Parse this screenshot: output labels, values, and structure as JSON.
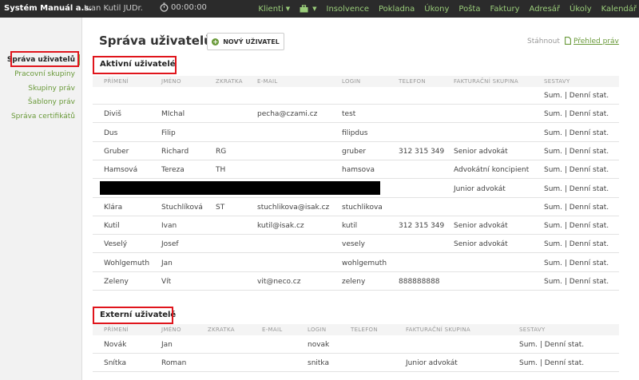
{
  "topbar": {
    "app_title": "Systém Manuál a.s.",
    "user": "Ivan Kutil JUDr.",
    "timer": "00:00:00",
    "nav": [
      {
        "label": "Klienti",
        "dropdown": true
      },
      {
        "label": "",
        "icon": "briefcase-icon",
        "dropdown": true
      },
      {
        "label": "Insolvence"
      },
      {
        "label": "Pokladna"
      },
      {
        "label": "Úkony"
      },
      {
        "label": "Pošta"
      },
      {
        "label": "Faktury"
      },
      {
        "label": "Adresář"
      },
      {
        "label": "Úkoly"
      },
      {
        "label": "Kalendář"
      }
    ]
  },
  "sidebar": {
    "items": [
      {
        "label": "Správa uživatelů",
        "active": true
      },
      {
        "label": "Pracovní skupiny"
      },
      {
        "label": "Skupiny práv"
      },
      {
        "label": "Šablony práv"
      },
      {
        "label": "Správa certifikátů"
      }
    ]
  },
  "header": {
    "title": "Správa uživatelů",
    "new_button": "NOVÝ UŽIVATEL",
    "download": "Stáhnout",
    "rights_overview": "Přehled práv"
  },
  "active_users": {
    "title": "Aktivní uživatelé",
    "columns": [
      "PŘÍMENÍ",
      "JMÉNO",
      "ZKRATKA",
      "E-MAIL",
      "LOGIN",
      "TELEFON",
      "FAKTURAČNÍ SKUPINA",
      "SESTAVY"
    ],
    "rows": [
      {
        "surname": "",
        "name": "",
        "abbr": "",
        "email": "",
        "login": "",
        "phone": "",
        "group": "",
        "reports": "Sum. | Denní stat."
      },
      {
        "surname": "Diviš",
        "name": "MIchal",
        "abbr": "",
        "email": "pecha@czami.cz",
        "login": "test",
        "phone": "",
        "group": "",
        "reports": "Sum. | Denní stat."
      },
      {
        "surname": "Dus",
        "name": "Filip",
        "abbr": "",
        "email": "",
        "login": "filipdus",
        "phone": "",
        "group": "",
        "reports": "Sum. | Denní stat."
      },
      {
        "surname": "Gruber",
        "name": "Richard",
        "abbr": "RG",
        "email": "",
        "login": "gruber",
        "phone": "312 315 349",
        "group": "Senior advokát",
        "reports": "Sum. | Denní stat."
      },
      {
        "surname": "Hamsová",
        "name": "Tereza",
        "abbr": "TH",
        "email": "",
        "login": "hamsova",
        "phone": "",
        "group": "Advokátní koncipient",
        "reports": "Sum. | Denní stat."
      },
      {
        "surname": "",
        "name": "",
        "abbr": "",
        "email": "",
        "login": "",
        "phone": "",
        "group": "Junior advokát",
        "reports": "Sum. | Denní stat.",
        "redacted": true
      },
      {
        "surname": "Klára",
        "name": "Stuchlíková",
        "abbr": "ST",
        "email": "stuchlikova@isak.cz",
        "login": "stuchlikova",
        "phone": "",
        "group": "",
        "reports": "Sum. | Denní stat."
      },
      {
        "surname": "Kutil",
        "name": "Ivan",
        "abbr": "",
        "email": "kutil@isak.cz",
        "login": "kutil",
        "phone": "312 315 349",
        "group": "Senior advokát",
        "reports": "Sum. | Denní stat."
      },
      {
        "surname": "Veselý",
        "name": "Josef",
        "abbr": "",
        "email": "",
        "login": "vesely",
        "phone": "",
        "group": "Senior advokát",
        "reports": "Sum. | Denní stat."
      },
      {
        "surname": "Wohlgemuth",
        "name": "Jan",
        "abbr": "",
        "email": "",
        "login": "wohlgemuth",
        "phone": "",
        "group": "",
        "reports": "Sum. | Denní stat."
      },
      {
        "surname": "Zeleny",
        "name": "Vít",
        "abbr": "",
        "email": "vit@neco.cz",
        "login": "zeleny",
        "phone": "888888888",
        "group": "",
        "reports": "Sum. | Denní stat."
      }
    ]
  },
  "external_users": {
    "title": "Externí uživatelé",
    "columns": [
      "PŘÍMENÍ",
      "JMÉNO",
      "ZKRATKA",
      "E-MAIL",
      "LOGIN",
      "TELEFON",
      "FAKTURAČNÍ SKUPINA",
      "SESTAVY"
    ],
    "rows": [
      {
        "surname": "Novák",
        "name": "Jan",
        "abbr": "",
        "email": "",
        "login": "novak",
        "phone": "",
        "group": "",
        "reports": "Sum. | Denní stat."
      },
      {
        "surname": "Snítka",
        "name": "Roman",
        "abbr": "",
        "email": "",
        "login": "snitka",
        "phone": "",
        "group": "Junior advokát",
        "reports": "Sum. | Denní stat."
      }
    ]
  },
  "colors": {
    "accent_green": "#6a9a3a",
    "topbar_bg": "#2b2b2b",
    "highlight_red": "#e0151c"
  }
}
